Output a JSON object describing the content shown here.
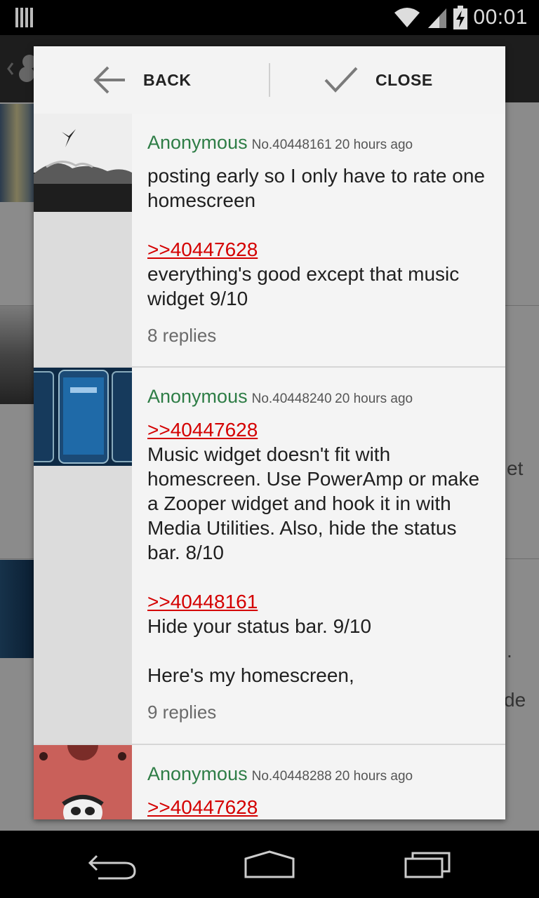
{
  "status_bar": {
    "time": "00:01",
    "icons": [
      "notification-bars-icon",
      "wifi-icon",
      "signal-icon",
      "battery-charging-icon"
    ]
  },
  "dialog": {
    "back_label": "BACK",
    "close_label": "CLOSE"
  },
  "posts": [
    {
      "name": "Anonymous",
      "number": "No.40448161",
      "time": "20 hours ago",
      "lines": [
        {
          "type": "text",
          "text": "posting early so I only have to rate one homescreen"
        },
        {
          "type": "gap"
        },
        {
          "type": "quote",
          "text": ">>40447628"
        },
        {
          "type": "text",
          "text": "everything's good except that music widget 9/10"
        }
      ],
      "replies": "8 replies"
    },
    {
      "name": "Anonymous",
      "number": "No.40448240",
      "time": "20 hours ago",
      "lines": [
        {
          "type": "quote",
          "text": ">>40447628"
        },
        {
          "type": "text",
          "text": "Music widget doesn't fit with homescreen. Use PowerAmp or make a Zooper widget and hook it in with Media Utilities. Also, hide the status bar. 8/10"
        },
        {
          "type": "gap"
        },
        {
          "type": "quote",
          "text": ">>40448161"
        },
        {
          "type": "text",
          "text": "Hide your status bar. 9/10"
        },
        {
          "type": "gap"
        },
        {
          "type": "text",
          "text": "Here's my homescreen,"
        }
      ],
      "replies": "9 replies"
    },
    {
      "name": "Anonymous",
      "number": "No.40448288",
      "time": "20 hours ago",
      "lines": [
        {
          "type": "quote",
          "text": ">>40447628"
        }
      ],
      "replies": ""
    }
  ],
  "background": {
    "fragments": [
      "et",
      ".",
      "de"
    ]
  },
  "nav": {
    "buttons": [
      "back-icon",
      "home-icon",
      "recents-icon"
    ]
  }
}
